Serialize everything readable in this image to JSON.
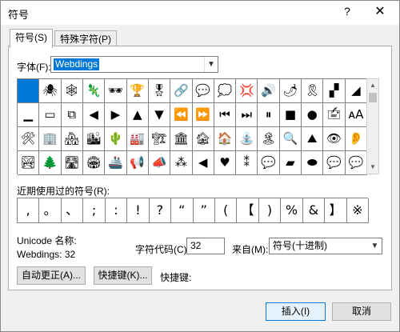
{
  "window": {
    "title": "符号",
    "help": "?",
    "close": "✕"
  },
  "tabs": [
    {
      "label": "符号(S)"
    },
    {
      "label": "特殊字符(P)"
    }
  ],
  "font": {
    "label": "字体(F):",
    "value": "Webdings"
  },
  "symbol_grid": {
    "rows": [
      [
        "",
        "🕷",
        "🕸",
        "🦎",
        "🕶",
        "🏆",
        "🎖",
        "🔗",
        "💬",
        "💭",
        "💢",
        "🔊",
        "🌶",
        "🎗",
        "▞",
        "◢"
      ],
      [
        "▁",
        "▭",
        "⧉",
        "◀",
        "▶",
        "▲",
        "▼",
        "⏪",
        "⏩",
        "⏮",
        "⏭",
        "⏸",
        "■",
        "●",
        "🖆",
        "ᴀA"
      ],
      [
        "🛠",
        "🏢",
        "🏘",
        "🏙",
        "🌵",
        "🏭",
        "🏗",
        "🏛",
        "🏚",
        "🏠",
        "⛲",
        "🏝",
        "🔍",
        "⛰",
        "👁",
        "👂"
      ],
      [
        "🏞",
        "🌲",
        "🛣",
        "🏟",
        "🚢",
        "📢",
        "📣",
        "⁂",
        "◀",
        "♥",
        "⁑",
        "💬",
        "▰",
        "⬬",
        "💬",
        "💬"
      ]
    ]
  },
  "recent": {
    "label": "近期使用过的符号(R):",
    "symbols": [
      ",",
      "。",
      "、",
      ";",
      ":",
      "!",
      "?",
      "“",
      "”",
      "(",
      "【",
      ")",
      "%",
      "&",
      "】",
      "※"
    ]
  },
  "info": {
    "unicode_name_label": "Unicode 名称:",
    "font_code_label": "Webdings: 32"
  },
  "char_code": {
    "label": "字符代码(C):",
    "value": "32"
  },
  "from": {
    "label": "来自(M):",
    "value": "符号(十进制)"
  },
  "buttons": {
    "autocorrect": "自动更正(A)...",
    "shortcut_key": "快捷键(K)...",
    "shortcut_label": "快捷键:",
    "insert": "插入(I)",
    "cancel": "取消"
  }
}
